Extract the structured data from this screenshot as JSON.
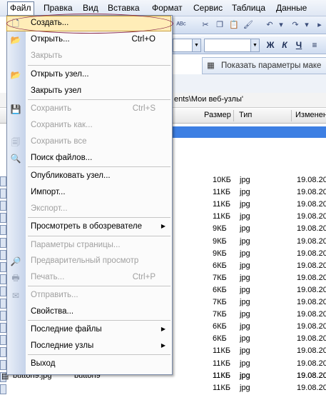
{
  "menubar": [
    "Файл",
    "Правка",
    "Вид",
    "Вставка",
    "Формат",
    "Сервис",
    "Таблица",
    "Данные"
  ],
  "toolbar": {
    "show_params_label": "Показать параметры маке",
    "bold": "Ж",
    "italic": "К",
    "underline": "Ч"
  },
  "pathbar": {
    "path": "ents\\Мои веб-узлы'"
  },
  "list": {
    "headers": [
      "Размер",
      "Тип",
      "Изменен"
    ],
    "rows": [
      {
        "size": "10КБ",
        "type": "jpg",
        "date": "19.08.20"
      },
      {
        "size": "11КБ",
        "type": "jpg",
        "date": "19.08.20"
      },
      {
        "size": "11КБ",
        "type": "jpg",
        "date": "19.08.20"
      },
      {
        "size": "11КБ",
        "type": "jpg",
        "date": "19.08.20"
      },
      {
        "size": "9КБ",
        "type": "jpg",
        "date": "19.08.20"
      },
      {
        "size": "9КБ",
        "type": "jpg",
        "date": "19.08.20"
      },
      {
        "size": "9КБ",
        "type": "jpg",
        "date": "19.08.20"
      },
      {
        "size": "6КБ",
        "type": "jpg",
        "date": "19.08.20"
      },
      {
        "size": "7КБ",
        "type": "jpg",
        "date": "19.08.20"
      },
      {
        "size": "6КБ",
        "type": "jpg",
        "date": "19.08.20"
      },
      {
        "size": "7КБ",
        "type": "jpg",
        "date": "19.08.20"
      },
      {
        "size": "7КБ",
        "type": "jpg",
        "date": "19.08.20"
      },
      {
        "size": "6КБ",
        "type": "jpg",
        "date": "19.08.20"
      },
      {
        "size": "6КБ",
        "type": "jpg",
        "date": "19.08.20"
      },
      {
        "size": "11КБ",
        "type": "jpg",
        "date": "19.08.20"
      },
      {
        "size": "11КБ",
        "type": "jpg",
        "date": "19.08.20"
      },
      {
        "size": "11КБ",
        "type": "jpg",
        "date": "19.08.20"
      },
      {
        "size": "11КБ",
        "type": "jpg",
        "date": "19.08.20"
      }
    ],
    "last_row": {
      "name": "button9.jpg",
      "title": "button9",
      "size": "11КБ",
      "type": "jpg",
      "date": "19.08.20"
    }
  },
  "file_menu": {
    "items": [
      {
        "label": "Создать...",
        "shortcut": "",
        "disabled": false,
        "icon": "new-doc-icon"
      },
      {
        "label": "Открыть...",
        "shortcut": "Ctrl+O",
        "disabled": false,
        "icon": "open-folder-icon"
      },
      {
        "label": "Закрыть",
        "shortcut": "",
        "disabled": true,
        "icon": ""
      },
      {
        "label": "Открыть узел...",
        "shortcut": "",
        "disabled": false,
        "icon": "open-site-icon"
      },
      {
        "label": "Закрыть узел",
        "shortcut": "",
        "disabled": false,
        "icon": ""
      },
      {
        "label": "Сохранить",
        "shortcut": "Ctrl+S",
        "disabled": true,
        "icon": "save-icon"
      },
      {
        "label": "Сохранить как...",
        "shortcut": "",
        "disabled": true,
        "icon": ""
      },
      {
        "label": "Сохранить все",
        "shortcut": "",
        "disabled": true,
        "icon": "save-all-icon"
      },
      {
        "label": "Поиск файлов...",
        "shortcut": "",
        "disabled": false,
        "icon": "search-files-icon"
      },
      {
        "label": "Опубликовать узел...",
        "shortcut": "",
        "disabled": false,
        "icon": ""
      },
      {
        "label": "Импорт...",
        "shortcut": "",
        "disabled": false,
        "icon": ""
      },
      {
        "label": "Экспорт...",
        "shortcut": "",
        "disabled": true,
        "icon": ""
      },
      {
        "label": "Просмотреть в обозревателе",
        "shortcut": "",
        "disabled": false,
        "icon": ""
      },
      {
        "label": "Параметры страницы...",
        "shortcut": "",
        "disabled": true,
        "icon": ""
      },
      {
        "label": "Предварительный просмотр",
        "shortcut": "",
        "disabled": true,
        "icon": "print-preview-icon"
      },
      {
        "label": "Печать...",
        "shortcut": "Ctrl+P",
        "disabled": true,
        "icon": "print-icon"
      },
      {
        "label": "Отправить...",
        "shortcut": "",
        "disabled": true,
        "icon": "send-icon"
      },
      {
        "label": "Свойства...",
        "shortcut": "",
        "disabled": false,
        "icon": ""
      },
      {
        "label": "Последние файлы",
        "shortcut": "",
        "disabled": false,
        "icon": ""
      },
      {
        "label": "Последние узлы",
        "shortcut": "",
        "disabled": false,
        "icon": ""
      },
      {
        "label": "Выход",
        "shortcut": "",
        "disabled": false,
        "icon": ""
      }
    ]
  },
  "colors": {
    "highlight": "#ffedb8",
    "selection_row": "#3d7fe3",
    "ellipse": "#8a2a4a"
  }
}
